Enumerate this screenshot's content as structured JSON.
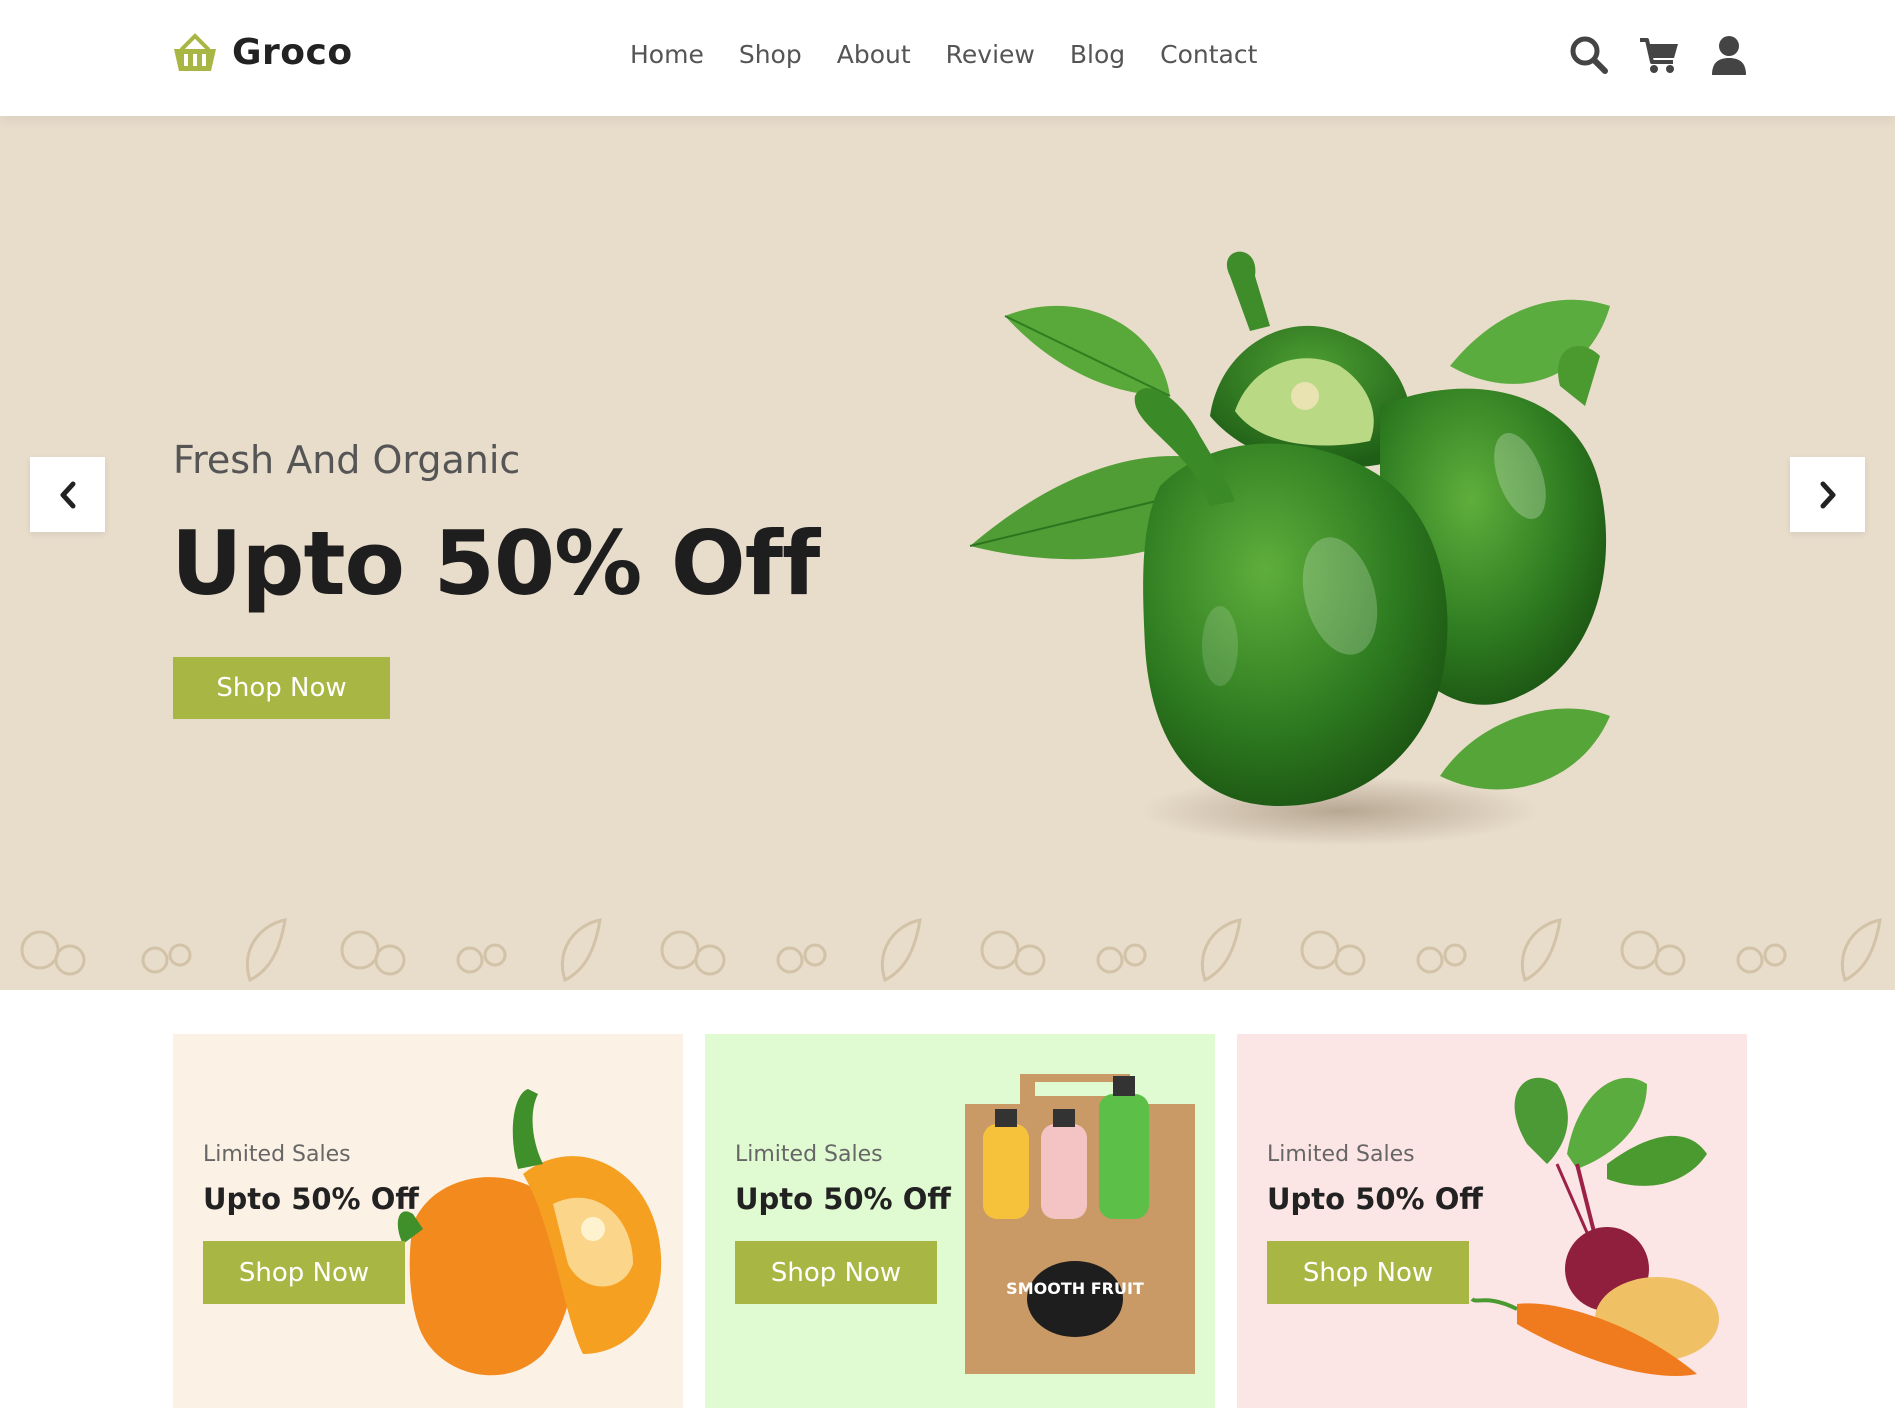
{
  "brand": {
    "name": "Groco",
    "accent": "#a8b744",
    "icon": "basket-icon"
  },
  "nav": {
    "items": [
      "Home",
      "Shop",
      "About",
      "Review",
      "Blog",
      "Contact"
    ]
  },
  "header_icons": [
    "search-icon",
    "cart-icon",
    "user-icon"
  ],
  "hero": {
    "subtitle": "Fresh And Organic",
    "title": "Upto 50% Off",
    "button": "Shop Now",
    "background": "#e8dccb",
    "prev_icon": "chevron-left-icon",
    "next_icon": "chevron-right-icon"
  },
  "promo_cards": [
    {
      "subtitle": "Limited Sales",
      "title": "Upto 50% Off",
      "button": "Shop Now",
      "background": "#fcf1e5"
    },
    {
      "subtitle": "Limited Sales",
      "title": "Upto 50% Off",
      "button": "Shop Now",
      "background": "#e0fad1",
      "product_label": "SMOOTH FRUIT"
    },
    {
      "subtitle": "Limited Sales",
      "title": "Upto 50% Off",
      "button": "Shop Now",
      "background": "#fce5e5"
    }
  ]
}
